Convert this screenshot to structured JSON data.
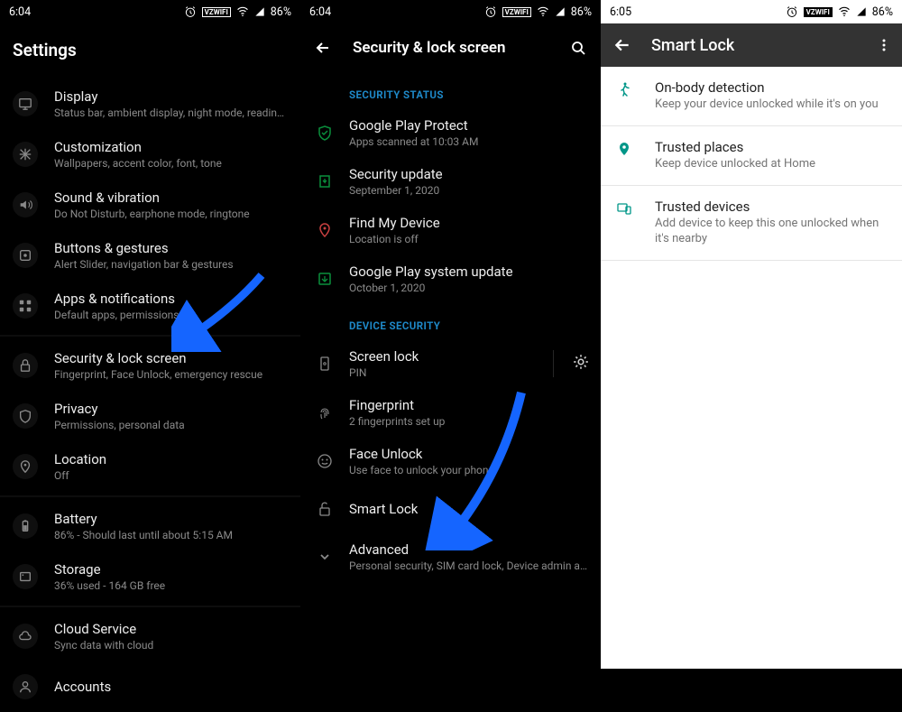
{
  "status": {
    "time1": "6:04",
    "time2": "6:04",
    "time3": "6:05",
    "carrier": "VZWIFI",
    "battery": "86%"
  },
  "p1": {
    "title": "Settings",
    "items": [
      {
        "icon": "display",
        "label": "Display",
        "sub": "Status bar, ambient display, night mode, reading mode"
      },
      {
        "icon": "customization",
        "label": "Customization",
        "sub": "Wallpapers, accent color, font, tone"
      },
      {
        "icon": "sound",
        "label": "Sound & vibration",
        "sub": "Do Not Disturb, earphone mode, ringtone"
      },
      {
        "icon": "buttons",
        "label": "Buttons & gestures",
        "sub": "Alert Slider, navigation bar & gestures"
      },
      {
        "icon": "apps",
        "label": "Apps & notifications",
        "sub": "Default apps, permissions"
      },
      {
        "icon": "lock",
        "label": "Security & lock screen",
        "sub": "Fingerprint, Face Unlock, emergency rescue"
      },
      {
        "icon": "privacy",
        "label": "Privacy",
        "sub": "Permissions, personal data"
      },
      {
        "icon": "location",
        "label": "Location",
        "sub": "Off"
      },
      {
        "icon": "battery",
        "label": "Battery",
        "sub": "86% - Should last until about 5:15 AM"
      },
      {
        "icon": "storage",
        "label": "Storage",
        "sub": "36% used - 164 GB free"
      },
      {
        "icon": "cloud",
        "label": "Cloud Service",
        "sub": "Sync data with cloud"
      },
      {
        "icon": "accounts",
        "label": "Accounts",
        "sub": ""
      }
    ],
    "separatorsAfter": [
      4,
      7,
      9
    ]
  },
  "p2": {
    "title": "Security & lock screen",
    "section1": "SECURITY STATUS",
    "section2": "DEVICE SECURITY",
    "rows1": [
      {
        "icon": "shield-green",
        "label": "Google Play Protect",
        "sub": "Apps scanned at 10:03 AM"
      },
      {
        "icon": "update-green",
        "label": "Security update",
        "sub": "September 1, 2020"
      },
      {
        "icon": "phone-red",
        "label": "Find My Device",
        "sub": "Location is off"
      },
      {
        "icon": "system-green",
        "label": "Google Play system update",
        "sub": "October 1, 2020"
      }
    ],
    "rows2": [
      {
        "icon": "lockscreen",
        "label": "Screen lock",
        "sub": "PIN",
        "gear": true
      },
      {
        "icon": "fingerprint",
        "label": "Fingerprint",
        "sub": "2 fingerprints set up"
      },
      {
        "icon": "face",
        "label": "Face Unlock",
        "sub": "Use face to unlock your phone"
      },
      {
        "icon": "smartlock",
        "label": "Smart Lock",
        "sub": ""
      },
      {
        "icon": "chevron",
        "label": "Advanced",
        "sub": "Personal security, SIM card lock, Device admin apps, E…"
      }
    ]
  },
  "p3": {
    "title": "Smart Lock",
    "rows": [
      {
        "icon": "walk",
        "label": "On-body detection",
        "sub": "Keep your device unlocked while it's on you"
      },
      {
        "icon": "pin",
        "label": "Trusted places",
        "sub": "Keep device unlocked at Home"
      },
      {
        "icon": "devices",
        "label": "Trusted devices",
        "sub": "Add device to keep this one unlocked when it's nearby"
      }
    ]
  }
}
